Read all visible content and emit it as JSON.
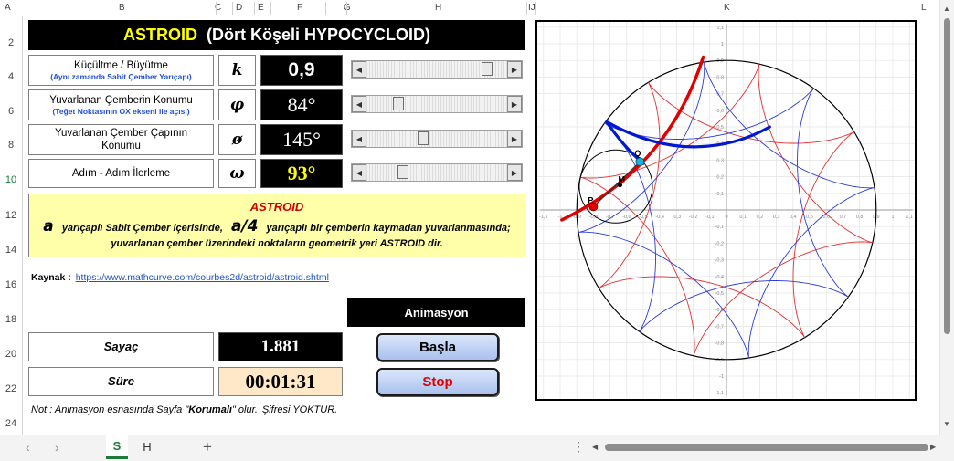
{
  "columns": [
    "A",
    "B",
    "C",
    "D",
    "E",
    "F",
    "G",
    "H",
    "IJ",
    "K",
    "L"
  ],
  "rows": [
    "2",
    "4",
    "6",
    "8",
    "10",
    "12",
    "14",
    "16",
    "18",
    "20",
    "22",
    "24"
  ],
  "title": {
    "main": "ASTROID",
    "sub": "(Dört Köşeli HYPOCYCLOID)"
  },
  "controls": [
    {
      "label": "Küçültme / Büyütme",
      "sub": "(Aynı zamanda Sabit Çember Yarıçapı)",
      "symbol": "k",
      "value": "0,9",
      "slider_fraction": 0.86
    },
    {
      "label": "Yuvarlanan Çemberin Konumu",
      "sub": "(Teğet Noktasının OX ekseni ile açısı)",
      "symbol": "φ",
      "value": "84°",
      "slider_fraction": 0.23
    },
    {
      "label": "Yuvarlanan Çember Çapının Konumu",
      "sub": "",
      "symbol": "ø",
      "value": "145°",
      "slider_fraction": 0.4
    },
    {
      "label": "Adım - Adım İlerleme",
      "symbol": "ω",
      "value": "93°",
      "slider_fraction": 0.26
    }
  ],
  "info": {
    "heading": "ASTROID",
    "a": "a",
    "line1_mid": "yarıçaplı  Sabit Çember içerisinde,",
    "a4": "a/4",
    "line1_end": "yarıçaplı bir çemberin kaymadan yuvarlanmasında;",
    "line2": "yuvarlanan çember üzerindeki noktaların geometrik yeri ASTROID dir."
  },
  "source": {
    "label": "Kaynak :",
    "url": "https://www.mathcurve.com/courbes2d/astroid/astroid.shtml"
  },
  "animation": {
    "header": "Animasyon",
    "start": "Başla",
    "stop": "Stop"
  },
  "counter": {
    "label": "Sayaç",
    "value": "1.881"
  },
  "time": {
    "label": "Süre",
    "value": "00:01:31"
  },
  "note": {
    "prefix": "Not : Animasyon esnasında Sayfa \"",
    "bold": "Korumalı",
    "mid": "\" olur.",
    "link": "Şifresi YOKTUR",
    "suffix": "."
  },
  "tabs": [
    "S",
    "H"
  ],
  "plot": {
    "ticks": [
      "-1,1",
      "-1",
      "-0,9",
      "-0,8",
      "-0,7",
      "-0,6",
      "-0,5",
      "-0,4",
      "-0,3",
      "-0,2",
      "-0,1",
      "0",
      "0,1",
      "0,2",
      "0,3",
      "0,4",
      "0,5",
      "0,6",
      "0,7",
      "0,8",
      "0,9",
      "1",
      "1,1"
    ],
    "point_labels": {
      "P": "P",
      "Q": "Q",
      "M": "M"
    },
    "colors": {
      "red": "#e00000",
      "blue": "#0018d0",
      "thin_red": "#e23030",
      "thin_blue": "#2a3bd6",
      "cyan": "#1ab3d6"
    }
  }
}
